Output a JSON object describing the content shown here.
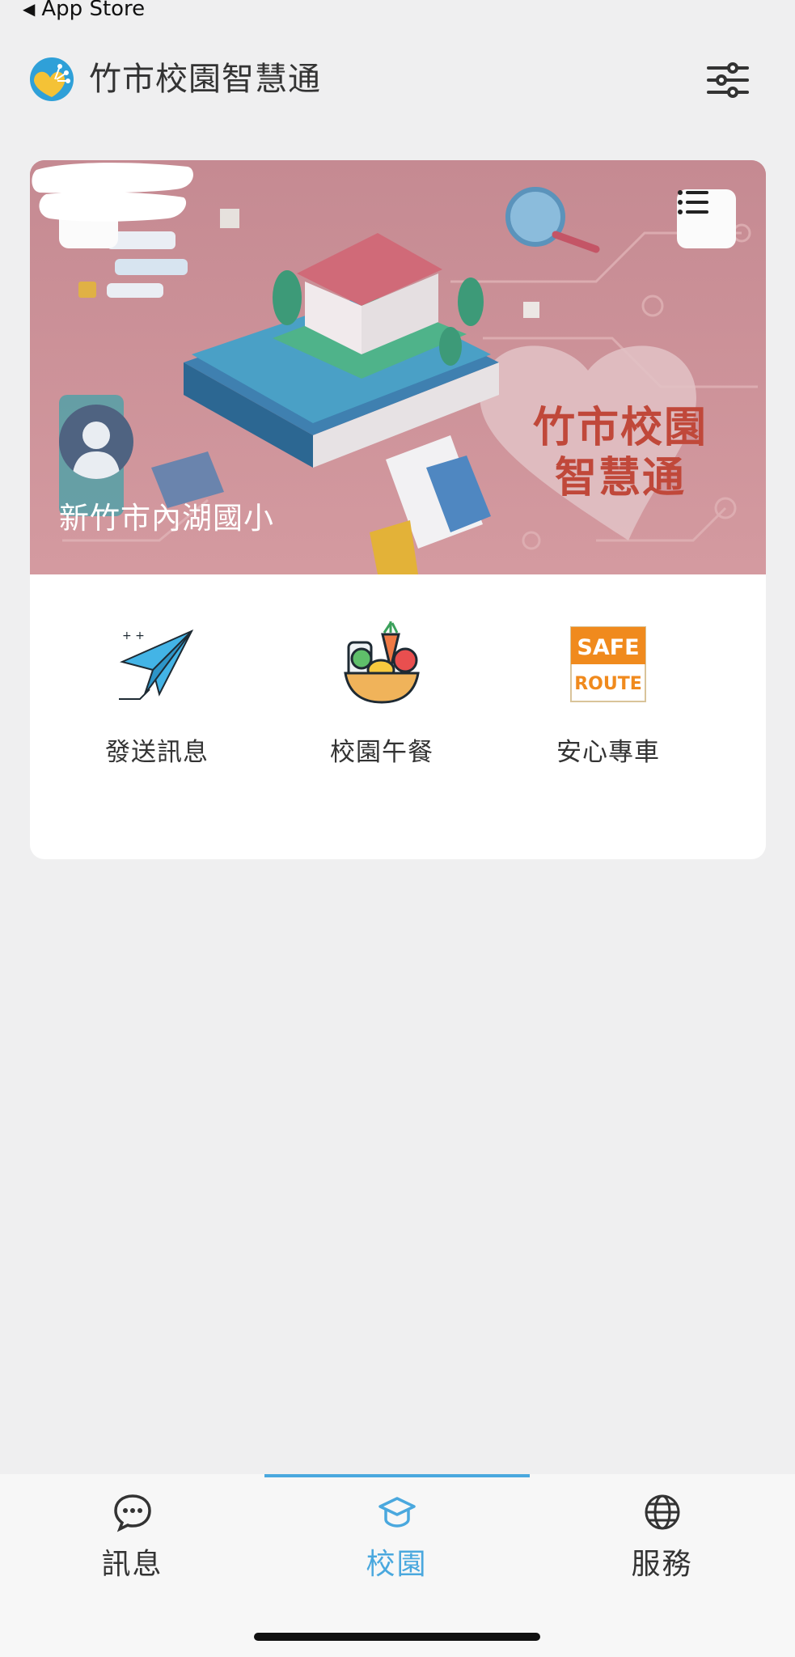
{
  "status": {
    "back_label": "App Store"
  },
  "header": {
    "title": "竹市校園智慧通"
  },
  "banner": {
    "school_name": "新竹市內湖國小",
    "logo_line1": "竹市校園",
    "logo_line2": "智慧通"
  },
  "services": [
    {
      "label": "發送訊息",
      "icon": "paper-plane-icon"
    },
    {
      "label": "校園午餐",
      "icon": "lunch-basket-icon"
    },
    {
      "label": "安心專車",
      "icon": "safe-route-icon",
      "icon_text1": "SAFE",
      "icon_text2": "ROUTE"
    }
  ],
  "tabs": [
    {
      "label": "訊息",
      "icon": "chat-bubble-icon",
      "active": false
    },
    {
      "label": "校園",
      "icon": "graduation-cap-icon",
      "active": true
    },
    {
      "label": "服務",
      "icon": "globe-icon",
      "active": false
    }
  ],
  "colors": {
    "accent": "#4aa8de",
    "banner": "#c98f95",
    "safe_orange": "#f08a1d"
  }
}
